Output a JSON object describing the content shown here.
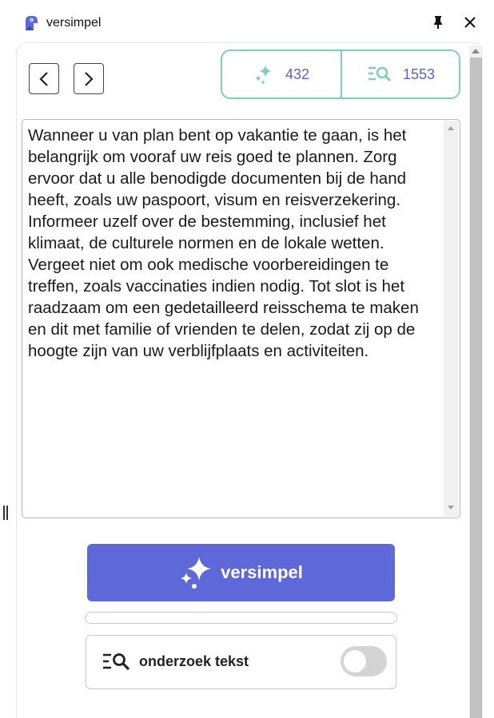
{
  "app": {
    "title": "versimpel",
    "brand_color": "#5f68d8",
    "accent_color": "#7dcfb6"
  },
  "icons": {
    "logo": "versimpel-logo-icon",
    "pin": "pin-icon",
    "close": "close-icon",
    "prev": "chevron-left-icon",
    "next": "chevron-right-icon",
    "sparkle": "sparkles-icon",
    "analyze": "text-search-icon"
  },
  "stats": {
    "simplified_count": "432",
    "analyzed_count": "1553"
  },
  "editor": {
    "text": "Wanneer u van plan bent op vakantie te gaan, is het belangrijk om vooraf uw reis goed te plannen. Zorg ervoor dat u alle benodigde documenten bij de hand heeft, zoals uw paspoort, visum en reisverzekering. Informeer uzelf over de bestemming, inclusief het klimaat, de culturele normen en de lokale wetten. Vergeet niet om ook medische voorbereidingen te treffen, zoals vaccinaties indien nodig. Tot slot is het raadzaam om een gedetailleerd reisschema te maken en dit met familie of vrienden te delen, zodat zij op de hoogte zijn van uw verblijfplaats en activiteiten."
  },
  "actions": {
    "simplify_label": "versimpel",
    "progress_fraction": 0
  },
  "analyze": {
    "label": "onderzoek tekst",
    "enabled": false
  }
}
